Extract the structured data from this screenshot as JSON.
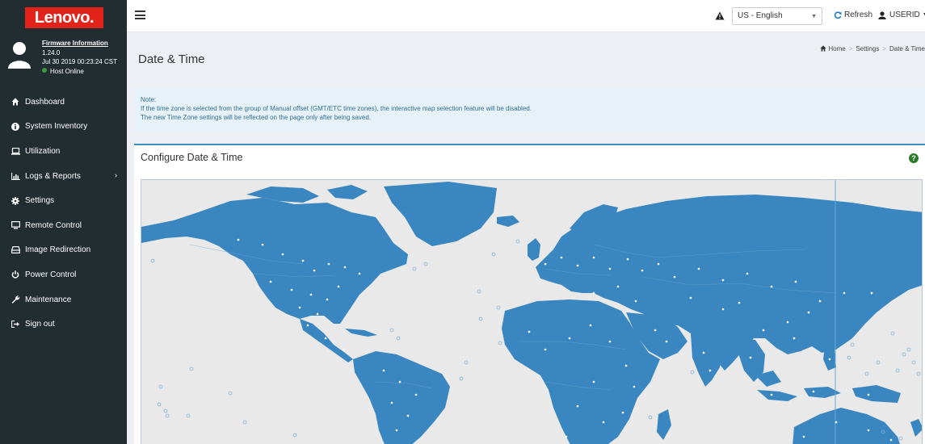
{
  "brand": {
    "logo_text": "Lenovo."
  },
  "user_panel": {
    "firmware_title": "Firmware Information",
    "firmware_version": "1.24.0",
    "datetime": "Jul 30 2019 00:23:24 CST",
    "host_status": "Host Online"
  },
  "sidebar": {
    "items": [
      {
        "label": "Dashboard",
        "icon": "home-icon"
      },
      {
        "label": "System Inventory",
        "icon": "info-icon"
      },
      {
        "label": "Utilization",
        "icon": "laptop-icon"
      },
      {
        "label": "Logs & Reports",
        "icon": "chart-icon"
      },
      {
        "label": "Settings",
        "icon": "gear-icon"
      },
      {
        "label": "Remote Control",
        "icon": "monitor-icon"
      },
      {
        "label": "Image Redirection",
        "icon": "drive-icon"
      },
      {
        "label": "Power Control",
        "icon": "power-icon"
      },
      {
        "label": "Maintenance",
        "icon": "wrench-icon"
      },
      {
        "label": "Sign out",
        "icon": "sign-out-icon"
      }
    ]
  },
  "topbar": {
    "language": "US - English",
    "refresh_label": "Refresh",
    "user_label": "USERID"
  },
  "page": {
    "title": "Date & Time",
    "breadcrumb": {
      "home": "Home",
      "settings": "Settings",
      "current": "Date & Time"
    }
  },
  "note": {
    "heading": "Note:",
    "line1": "If the time zone is selected from the group of Manual offset (GMT/ETC time zones), the interactive map selection feature will be disabled.",
    "line2": "The new Time Zone settings will be reflected on the page only after being saved."
  },
  "panel": {
    "title": "Configure Date & Time",
    "help": "?"
  },
  "colors": {
    "sidebar_bg": "#222d32",
    "brand_red": "#e2231a",
    "map_land": "#3a86c0",
    "accent": "#3c8dbc"
  }
}
